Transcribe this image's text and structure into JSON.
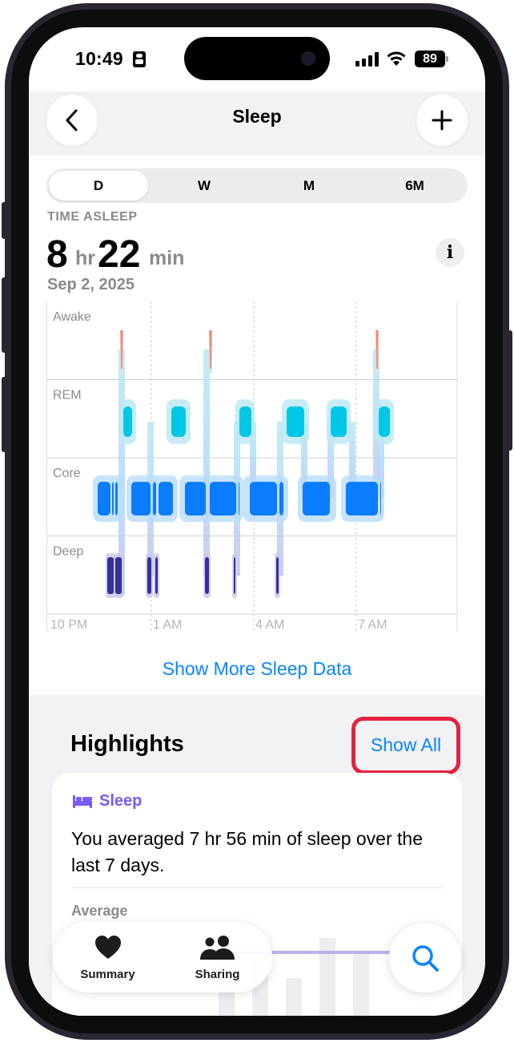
{
  "status_bar": {
    "time": "10:49",
    "battery": "89"
  },
  "nav": {
    "title": "Sleep"
  },
  "segments": [
    {
      "label": "D",
      "active": true
    },
    {
      "label": "W",
      "active": false
    },
    {
      "label": "M",
      "active": false
    },
    {
      "label": "6M",
      "active": false
    }
  ],
  "summary": {
    "label": "TIME ASLEEP",
    "hours": "8",
    "hours_unit": "hr",
    "minutes": "22",
    "minutes_unit": "min",
    "date": "Sep 2, 2025"
  },
  "chart_data": {
    "type": "timeline",
    "stages": [
      "Awake",
      "REM",
      "Core",
      "Deep"
    ],
    "x_tick_labels": [
      "10 PM",
      "1 AM",
      "4 AM",
      "7 AM"
    ],
    "colors": {
      "Awake": "#f4826e",
      "REM": "#00c7e6",
      "Core": "#0a7cff",
      "Deep": "#33309e"
    }
  },
  "links": {
    "show_more": "Show More Sleep Data"
  },
  "highlights": {
    "title": "Highlights",
    "show_all": "Show All",
    "card": {
      "category": "Sleep",
      "text": "You averaged 7 hr 56 min of sleep over the last 7 days.",
      "average_label": "Average"
    }
  },
  "tabbar": {
    "summary": "Summary",
    "sharing": "Sharing"
  }
}
